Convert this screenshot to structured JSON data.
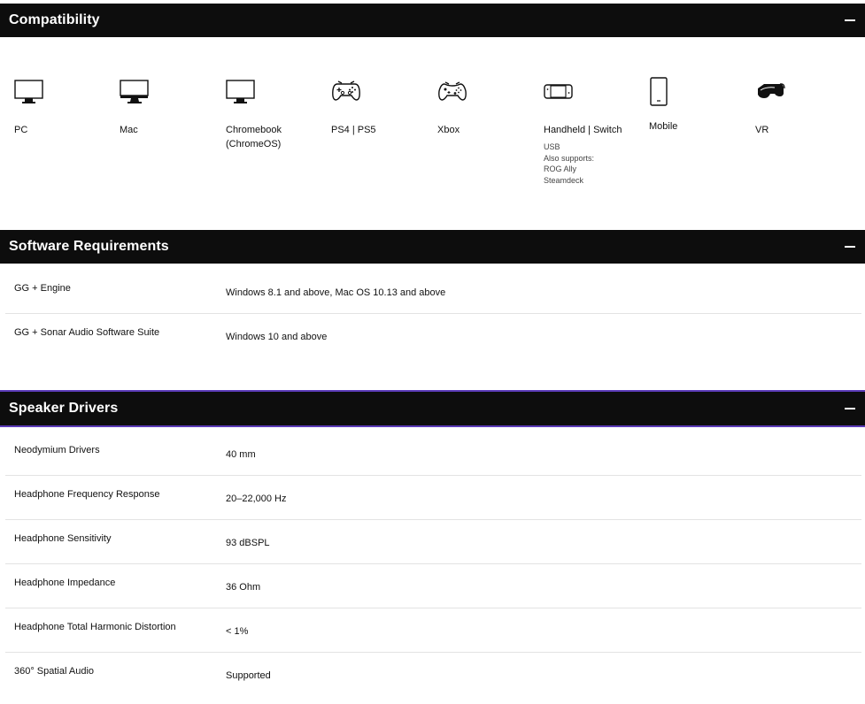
{
  "compatibility": {
    "title": "Compatibility",
    "devices": [
      {
        "icon": "monitor-icon",
        "label": "PC"
      },
      {
        "icon": "monitor-stand-icon",
        "label": "Mac"
      },
      {
        "icon": "monitor-icon",
        "label": "Chromebook (ChromeOS)"
      },
      {
        "icon": "gamepad-icon",
        "label": "PS4 | PS5"
      },
      {
        "icon": "xbox-controller-icon",
        "label": "Xbox"
      },
      {
        "icon": "handheld-switch-icon",
        "label": "Handheld | Switch",
        "note": [
          "USB",
          "Also supports:",
          "ROG Ally",
          "Steamdeck"
        ]
      },
      {
        "icon": "mobile-phone-icon",
        "label": "Mobile"
      },
      {
        "icon": "vr-headset-icon",
        "label": "VR"
      }
    ]
  },
  "software": {
    "title": "Software Requirements",
    "rows": [
      {
        "key": "GG + Engine",
        "value": "Windows 8.1 and above, Mac OS 10.13 and above"
      },
      {
        "key": "GG + Sonar Audio Software Suite",
        "value": "Windows 10 and above"
      }
    ]
  },
  "drivers": {
    "title": "Speaker Drivers",
    "rows": [
      {
        "key": "Neodymium Drivers",
        "value": "40 mm"
      },
      {
        "key": "Headphone Frequency Response",
        "value": "20–22,000 Hz"
      },
      {
        "key": "Headphone Sensitivity",
        "value": "93 dBSPL"
      },
      {
        "key": "Headphone Impedance",
        "value": "36 Ohm"
      },
      {
        "key": "Headphone Total Harmonic Distortion",
        "value": "< 1%"
      },
      {
        "key": "360° Spatial Audio",
        "value": "Supported"
      }
    ]
  },
  "colors": {
    "header_bg": "#0d0d0d",
    "accent": "#5b3bb8",
    "divider": "#e3e3e3"
  }
}
